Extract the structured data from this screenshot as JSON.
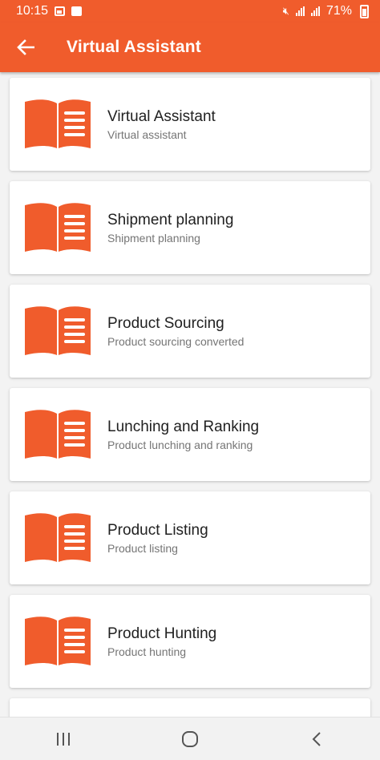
{
  "status_bar": {
    "time": "10:15",
    "battery": "71%"
  },
  "header": {
    "title": "Virtual Assistant"
  },
  "items": [
    {
      "title": "Virtual Assistant",
      "subtitle": "Virtual assistant"
    },
    {
      "title": "Shipment planning",
      "subtitle": "Shipment planning"
    },
    {
      "title": "Product Sourcing",
      "subtitle": "Product sourcing converted"
    },
    {
      "title": "Lunching and Ranking",
      "subtitle": "Product lunching and ranking"
    },
    {
      "title": "Product Listing",
      "subtitle": "Product listing"
    },
    {
      "title": "Product Hunting",
      "subtitle": "Product hunting"
    },
    {
      "title": "",
      "subtitle": ""
    }
  ],
  "colors": {
    "accent": "#f05c2c",
    "background": "#f3f3f3",
    "card": "#ffffff"
  },
  "icons": {
    "back": "arrow-left-icon",
    "item": "open-book-icon",
    "nav_recents": "recents-icon",
    "nav_home": "home-icon",
    "nav_back": "nav-back-icon"
  }
}
